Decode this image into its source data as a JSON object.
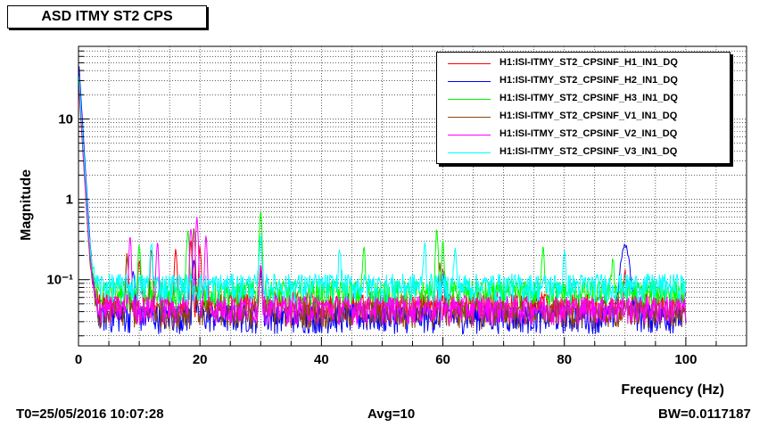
{
  "title": "ASD ITMY ST2 CPS",
  "footer": {
    "t0": "T0=25/05/2016 10:07:28",
    "avg": "Avg=10",
    "bw": "BW=0.0117187"
  },
  "chart_data": {
    "type": "line",
    "title": "ASD ITMY ST2 CPS",
    "xlabel": "Frequency (Hz)",
    "ylabel": "Magnitude",
    "xlim": [
      0,
      110
    ],
    "ylim": [
      0.015,
      80
    ],
    "yscale": "log",
    "grid": true,
    "legend_position": "top-right",
    "x_ticks": [
      0,
      20,
      40,
      60,
      80,
      100
    ],
    "x_tick_labels": [
      "0",
      "20",
      "40",
      "60",
      "80",
      "100"
    ],
    "y_ticks": [
      0.1,
      1,
      10
    ],
    "y_tick_labels": [
      "10⁻¹",
      "1",
      "10"
    ],
    "series": [
      {
        "name": "H1:ISI-ITMY_ST2_CPSINF_H1_IN1_DQ",
        "color": "#ff0000",
        "floor": 0.05,
        "peaks": [
          [
            0.1,
            50
          ],
          [
            8,
            0.15
          ],
          [
            10,
            0.12
          ],
          [
            16,
            0.2
          ],
          [
            18.5,
            0.25
          ],
          [
            20,
            0.2
          ],
          [
            30,
            0.1
          ],
          [
            59.5,
            0.1
          ],
          [
            90,
            0.07
          ]
        ]
      },
      {
        "name": "H1:ISI-ITMY_ST2_CPSINF_H2_IN1_DQ",
        "color": "#0000ff",
        "floor": 0.035,
        "peaks": [
          [
            0.1,
            60
          ],
          [
            9,
            0.1
          ],
          [
            19,
            0.15
          ],
          [
            30,
            0.1
          ],
          [
            60,
            0.09
          ],
          [
            90,
            0.23
          ]
        ]
      },
      {
        "name": "H1:ISI-ITMY_ST2_CPSINF_H3_IN1_DQ",
        "color": "#00ff00",
        "floor": 0.07,
        "peaks": [
          [
            0.1,
            40
          ],
          [
            10,
            0.2
          ],
          [
            18,
            0.35
          ],
          [
            30,
            0.65
          ],
          [
            47,
            0.18
          ],
          [
            59,
            0.35
          ],
          [
            60,
            0.22
          ],
          [
            76.5,
            0.2
          ],
          [
            88,
            0.12
          ]
        ]
      },
      {
        "name": "H1:ISI-ITMY_ST2_CPSINF_V1_IN1_DQ",
        "color": "#8b4513",
        "floor": 0.04,
        "peaks": [
          [
            0.1,
            30
          ],
          [
            8,
            0.15
          ],
          [
            12,
            0.2
          ],
          [
            19,
            0.4
          ],
          [
            30,
            0.1
          ],
          [
            60,
            0.1
          ]
        ]
      },
      {
        "name": "H1:ISI-ITMY_ST2_CPSINF_V2_IN1_DQ",
        "color": "#ff00ff",
        "floor": 0.045,
        "peaks": [
          [
            0.1,
            35
          ],
          [
            8.5,
            0.3
          ],
          [
            13,
            0.25
          ],
          [
            18.5,
            0.4
          ],
          [
            19.5,
            0.55
          ],
          [
            21,
            0.3
          ],
          [
            30,
            0.12
          ]
        ]
      },
      {
        "name": "H1:ISI-ITMY_ST2_CPSINF_V3_IN1_DQ",
        "color": "#00ffff",
        "floor": 0.085,
        "peaks": [
          [
            0.1,
            45
          ],
          [
            12,
            0.2
          ],
          [
            30,
            0.25
          ],
          [
            43,
            0.15
          ],
          [
            57,
            0.2
          ],
          [
            62,
            0.15
          ],
          [
            80,
            0.12
          ]
        ]
      }
    ]
  }
}
